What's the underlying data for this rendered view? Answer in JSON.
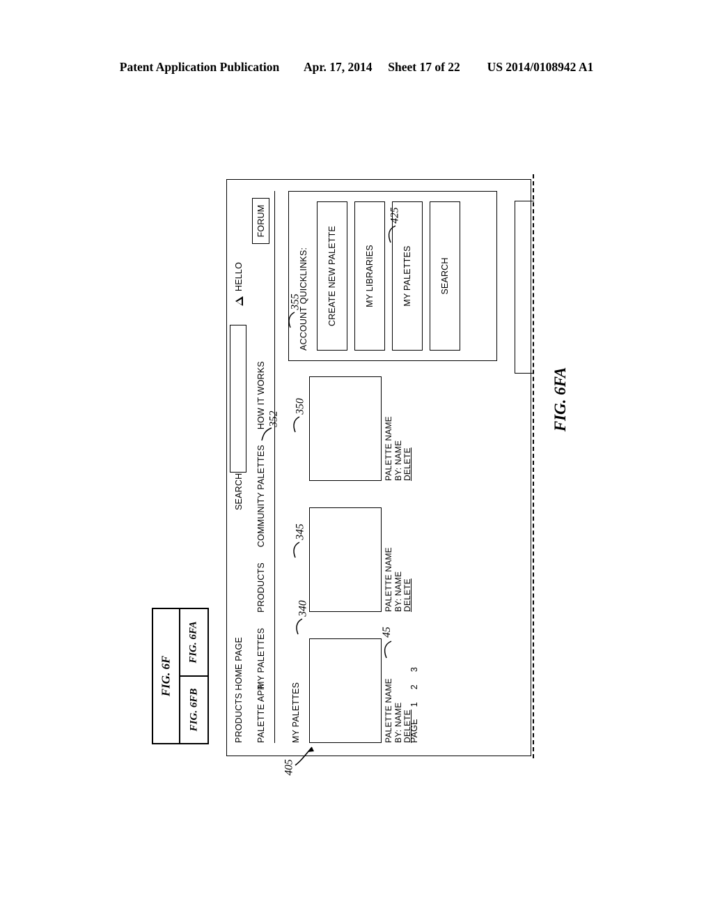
{
  "header": {
    "publication": "Patent Application Publication",
    "date": "Apr. 17, 2014",
    "sheet": "Sheet 17 of 22",
    "number": "US 2014/0108942 A1"
  },
  "figure_key": {
    "parent": "FIG. 6F",
    "parts": [
      "FIG. 6FA",
      "FIG. 6FB"
    ]
  },
  "figure_caption": "FIG. 6FA",
  "window": {
    "ref": "405",
    "top_bar_title": "PRODUCTS HOME PAGE",
    "app_name": "PALETTE APP",
    "nav": [
      {
        "label": "MY PALETTES",
        "ref": "340"
      },
      {
        "label": "PRODUCTS",
        "ref": "345"
      },
      {
        "label": "COMMUNITY PALETTES",
        "ref": "350"
      },
      {
        "label": "HOW IT WORKS",
        "ref": "355"
      }
    ],
    "search": {
      "label": "SEARCH",
      "value": "",
      "placeholder": "",
      "ref": "352"
    },
    "greeting": "HELLO",
    "greeting_icon": "triangle-avatar-icon",
    "forum_button": "FORUM"
  },
  "main": {
    "section_title": "MY PALETTES",
    "card_ref": "45",
    "cards": [
      {
        "name": "PALETTE NAME",
        "by": "BY: NAME",
        "delete": "DELETE"
      },
      {
        "name": "PALETTE NAME",
        "by": "BY: NAME",
        "delete": "DELETE"
      },
      {
        "name": "PALETTE NAME",
        "by": "BY: NAME",
        "delete": "DELETE"
      }
    ],
    "pagination": {
      "label": "PAGE",
      "pages": [
        "1",
        "2",
        "3"
      ]
    }
  },
  "quicklinks": {
    "title": "ACCOUNT QUICKLINKS:",
    "ref": "425",
    "buttons": [
      "CREATE NEW PALETTE",
      "MY LIBRARIES",
      "MY PALETTES",
      "SEARCH"
    ]
  }
}
